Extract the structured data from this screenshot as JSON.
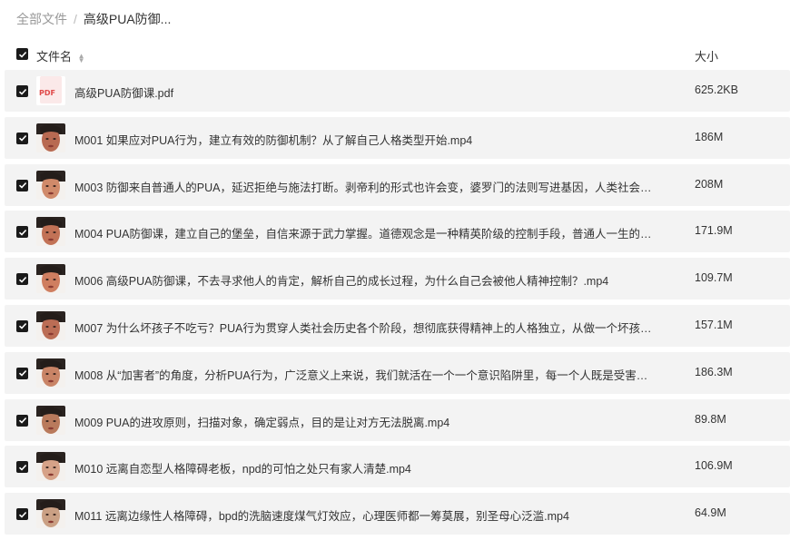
{
  "breadcrumb": {
    "root": "全部文件",
    "separator": "/",
    "current": "高级PUA防御..."
  },
  "header": {
    "name_col": "文件名",
    "size_col": "大小"
  },
  "pdf_label": "PDF",
  "files": [
    {
      "name": "高级PUA防御课.pdf",
      "size": "625.2KB",
      "icon": "pdf-icon"
    },
    {
      "name": "M001 如果应对PUA行为，建立有效的防御机制？从了解自己人格类型开始.mp4",
      "size": "186M",
      "icon": "video-thumbnail"
    },
    {
      "name": "M003 防御来自普通人的PUA，延迟拒绝与施法打断。剥帝利的形式也许会变，婆罗门的法则写进基因，人类社会诞生...",
      "size": "208M",
      "icon": "video-thumbnail"
    },
    {
      "name": "M004 PUA防御课，建立自己的堡垒，自信来源于武力掌握。道德观念是一种精英阶级的控制手段，普通人一生的目标...",
      "size": "171.9M",
      "icon": "video-thumbnail"
    },
    {
      "name": "M006 高级PUA防御课，不去寻求他人的肯定，解析自己的成长过程，为什么自己会被他人精神控制？.mp4",
      "size": "109.7M",
      "icon": "video-thumbnail"
    },
    {
      "name": "M007 为什么坏孩子不吃亏？PUA行为贯穿人类社会历史各个阶段，想彻底获得精神上的人格独立，从做一个坏孩子开...",
      "size": "157.1M",
      "icon": "video-thumbnail"
    },
    {
      "name": "M008 从“加害者”的角度，分析PUA行为，广泛意义上来说，我们就活在一个一个意识陷阱里，每一个人既是受害者...",
      "size": "186.3M",
      "icon": "video-thumbnail"
    },
    {
      "name": "M009 PUA的进攻原则，扫描对象，确定弱点，目的是让对方无法脱离.mp4",
      "size": "89.8M",
      "icon": "video-thumbnail"
    },
    {
      "name": "M010 远离自恋型人格障碍老板，npd的可怕之处只有家人清楚.mp4",
      "size": "106.9M",
      "icon": "video-thumbnail"
    },
    {
      "name": "M011 远离边缘性人格障碍，bpd的洗脑速度煤气灯效应，心理医师都一筹莫展，别圣母心泛滥.mp4",
      "size": "64.9M",
      "icon": "video-thumbnail"
    }
  ]
}
